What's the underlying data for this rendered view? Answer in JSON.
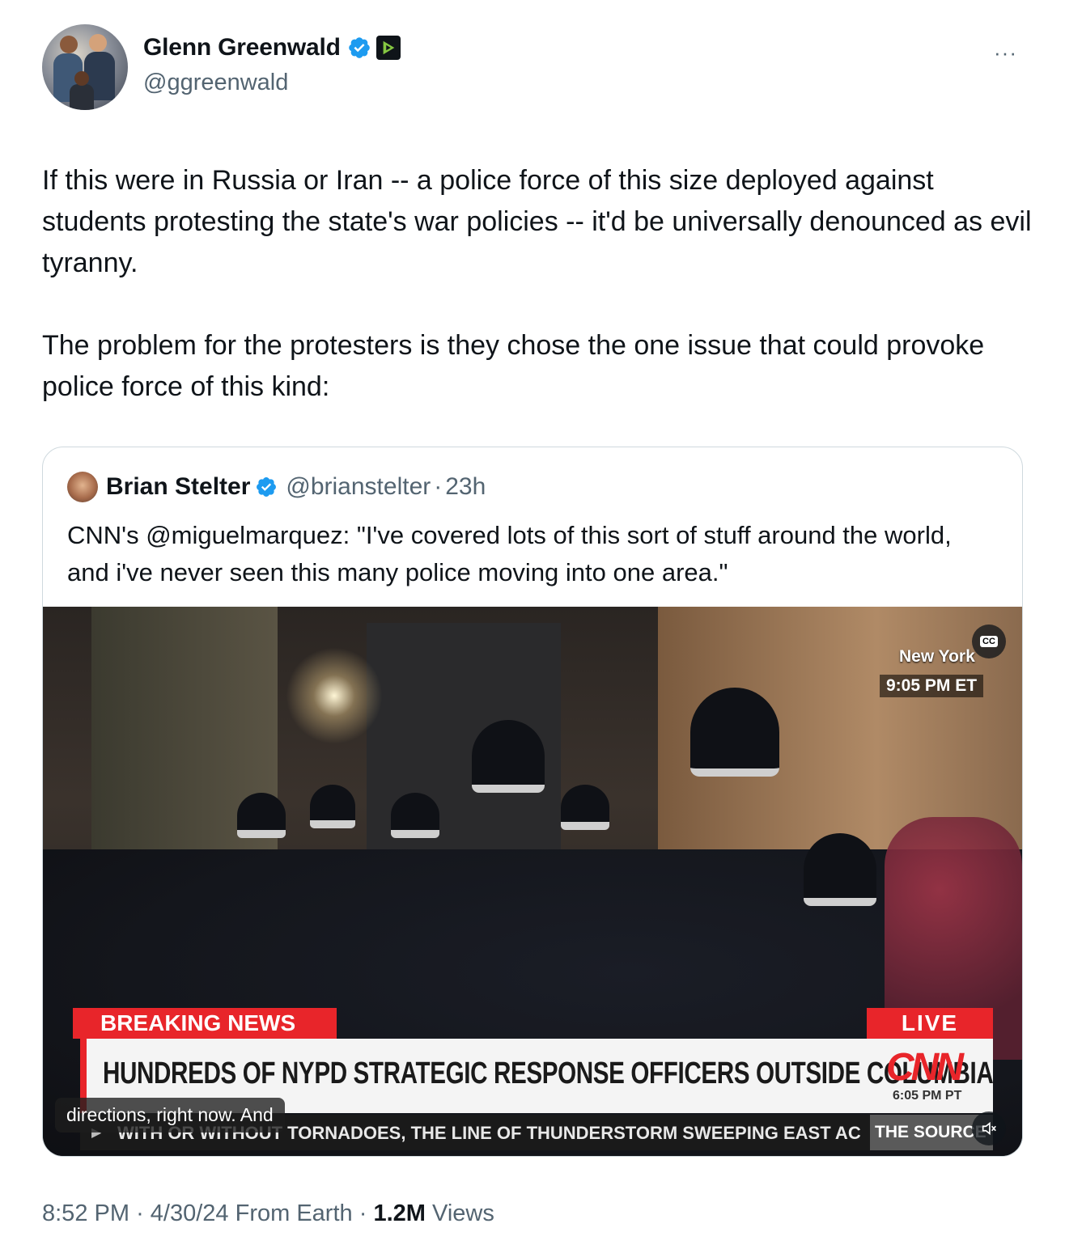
{
  "tweet": {
    "author": {
      "name": "Glenn Greenwald",
      "handle": "@ggreenwald",
      "verified_color": "#1d9bf0",
      "affiliation_icon": "rumble-play-icon"
    },
    "more_label": "···",
    "body": [
      "If this were in Russia or Iran -- a police force of this size deployed against students protesting the state's war policies -- it'd be universally denounced as evil tyranny.",
      "The problem for the protesters is they chose the one issue that could provoke police force of this kind:"
    ],
    "meta": {
      "time": "8:52 PM",
      "date": "4/30/24",
      "source": "From Earth",
      "sep": "·",
      "views_count": "1.2M",
      "views_label": "Views"
    }
  },
  "quote": {
    "author": {
      "name": "Brian Stelter",
      "handle": "@brianstelter",
      "time": "23h"
    },
    "text": "CNN's @miguelmarquez: \"I've covered lots of this sort of stuff around the world, and i've never seen this many police moving into one area.\"",
    "video": {
      "location": "New York",
      "location_time": "9:05 PM ET",
      "breaking_label": "BREAKING NEWS",
      "live_label": "LIVE",
      "headline": "HUNDREDS OF NYPD STRATEGIC RESPONSE OFFICERS OUTSIDE COLUMBIA",
      "network": "CNN",
      "network_time": "6:05 PM PT",
      "ticker": "WITH OR WITHOUT TORNADOES, THE LINE OF THUNDERSTORM SWEEPING EAST AC",
      "ticker_brand": "THE SOURCE",
      "caption": "directions, right now. And",
      "cc_label": "CC"
    }
  }
}
